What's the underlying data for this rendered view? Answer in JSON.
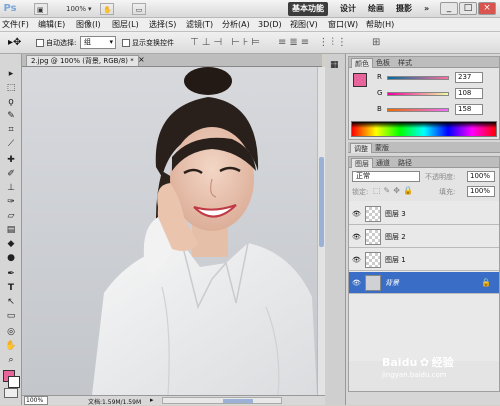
{
  "app": {
    "logo": "Ps",
    "zoom": "100%"
  },
  "workspaces": [
    "基本功能",
    "设计",
    "绘画",
    "摄影"
  ],
  "window_controls": {
    "minimize": "_",
    "restore": "□",
    "close": "×"
  },
  "menu": [
    "文件(F)",
    "编辑(E)",
    "图像(I)",
    "图层(L)",
    "选择(S)",
    "滤镜(T)",
    "分析(A)",
    "3D(D)",
    "视图(V)",
    "窗口(W)",
    "帮助(H)"
  ],
  "options": {
    "auto_select": "自动选择:",
    "group_value": "组",
    "show_transform": "显示变换控件"
  },
  "document": {
    "tab_title": "2.jpg @ 100% (背景, RGB/8) *",
    "status_zoom": "100%",
    "status_doc": "文档:1.59M/1.59M"
  },
  "colors": {
    "accent": "#3a6ec6",
    "foreground": "#e8649a",
    "background": "#ffffff"
  },
  "color_panel": {
    "tabs": [
      "颜色",
      "色板",
      "样式"
    ],
    "channels": [
      {
        "label": "R",
        "value": "237"
      },
      {
        "label": "G",
        "value": "108"
      },
      {
        "label": "B",
        "value": "158"
      }
    ]
  },
  "adjust_panel": {
    "tabs": [
      "调整",
      "蒙版"
    ]
  },
  "layers_panel": {
    "tabs": [
      "图层",
      "通道",
      "路径"
    ],
    "blend_mode": "正常",
    "opacity_label": "不透明度:",
    "opacity_value": "100%",
    "lock_label": "锁定:",
    "fill_label": "填充:",
    "fill_value": "100%",
    "layers": [
      {
        "name": "图层 3",
        "selected": false
      },
      {
        "name": "图层 2",
        "selected": false
      },
      {
        "name": "图层 1",
        "selected": false
      },
      {
        "name": "背景",
        "selected": true
      }
    ]
  },
  "watermark": {
    "brand": "Baidu",
    "cn": "经验",
    "url": "jingyan.baidu.com"
  }
}
